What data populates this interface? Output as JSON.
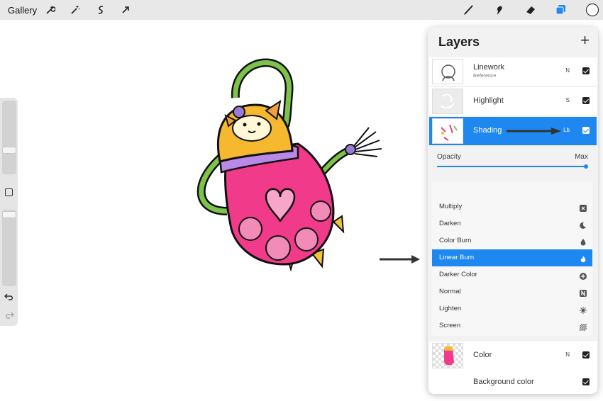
{
  "topbar": {
    "gallery_label": "Gallery",
    "left_tools": [
      "wrench-icon",
      "magic-wand-icon",
      "selection-icon",
      "transform-arrow-icon"
    ],
    "right_tools": [
      "brush-icon",
      "smudge-icon",
      "eraser-icon",
      "layers-icon",
      "color-swatch"
    ],
    "accent_color": "#1e88f0"
  },
  "sidebar": {
    "icons": [
      "modify-square-icon",
      "undo-icon",
      "redo-icon"
    ]
  },
  "layers_panel": {
    "title": "Layers",
    "add_label": "+",
    "layers_top": [
      {
        "name": "Linework",
        "sub": "Reference",
        "mode": "N",
        "checked": true
      },
      {
        "name": "Highlight",
        "sub": "",
        "mode": "S",
        "checked": true
      },
      {
        "name": "Shading",
        "sub": "",
        "mode": "Lb",
        "checked": true,
        "active": true
      }
    ],
    "opacity_label": "Opacity",
    "opacity_value_label": "Max",
    "opacity_fraction": 1.0,
    "blend_modes": [
      {
        "label": "Multiply",
        "icon": "multiply-icon"
      },
      {
        "label": "Darken",
        "icon": "moon-icon"
      },
      {
        "label": "Color Burn",
        "icon": "burn-drop-icon"
      },
      {
        "label": "Linear Burn",
        "icon": "flame-icon",
        "selected": true
      },
      {
        "label": "Darker Color",
        "icon": "plus-circle-icon"
      },
      {
        "label": "Normal",
        "icon": "n-icon"
      },
      {
        "label": "Lighten",
        "icon": "sun-icon"
      },
      {
        "label": "Screen",
        "icon": "screen-lines-icon"
      }
    ],
    "layers_bottom": [
      {
        "name": "Color",
        "mode": "N",
        "checked": true
      },
      {
        "name": "Background color",
        "mode": "",
        "checked": true
      }
    ]
  }
}
